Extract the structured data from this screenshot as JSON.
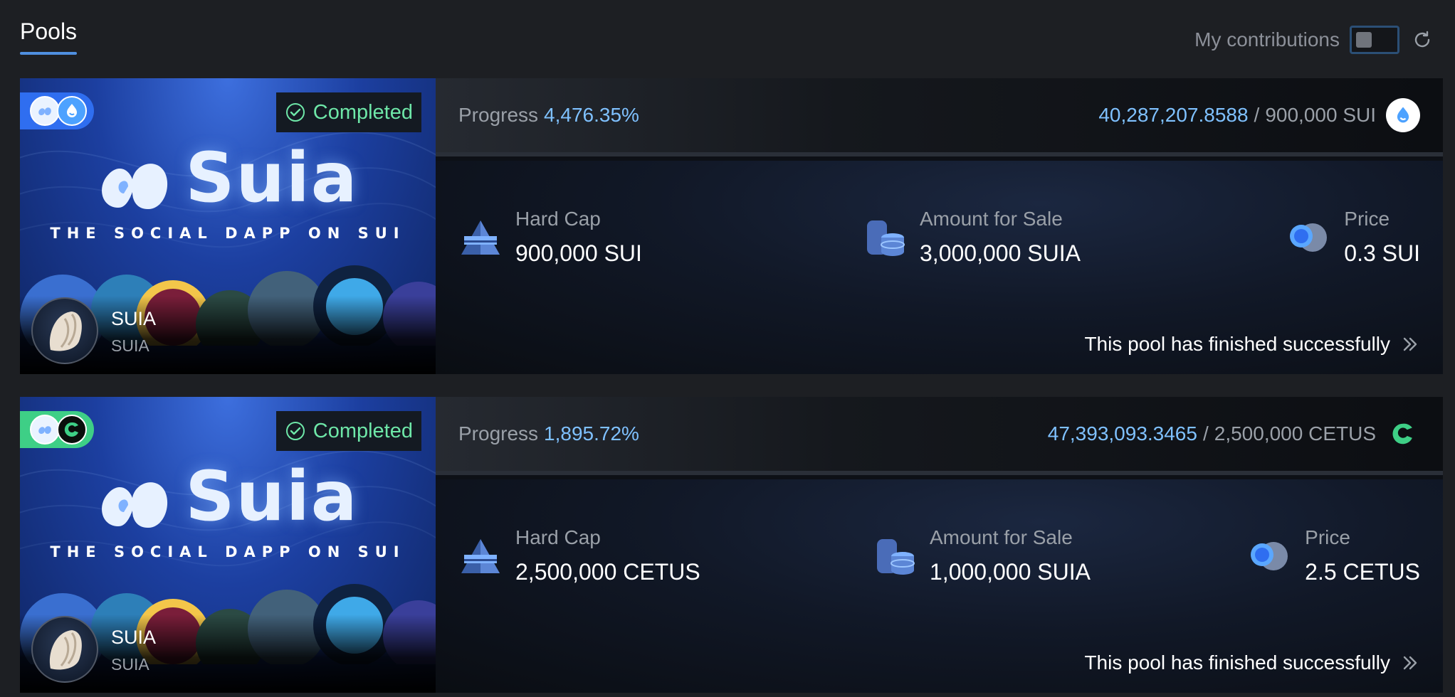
{
  "header": {
    "tab_label": "Pools",
    "contributions_label": "My contributions",
    "toggle_state": "off",
    "refresh_icon": "refresh-icon"
  },
  "pools": [
    {
      "status": "Completed",
      "banner": {
        "logo_word": "Suia",
        "tagline": "THE SOCIAL DAPP ON SUI"
      },
      "chain_icons": [
        "suia-icon",
        "sui-icon"
      ],
      "token_name": "SUIA",
      "token_symbol": "SUIA",
      "progress_label": "Progress",
      "progress_value": "4,476.35%",
      "raised_amount": "40,287,207.8588",
      "raised_separator": "/",
      "raised_target": "900,000 SUI",
      "raise_coin_icon": "sui-icon",
      "hard_cap_label": "Hard Cap",
      "hard_cap_value": "900,000 SUI",
      "amount_label": "Amount for Sale",
      "amount_value": "3,000,000 SUIA",
      "price_label": "Price",
      "price_value": "0.3 SUI",
      "finish_text": "This pool has finished successfully"
    },
    {
      "status": "Completed",
      "banner": {
        "logo_word": "Suia",
        "tagline": "THE SOCIAL DAPP ON SUI"
      },
      "chain_icons": [
        "suia-icon",
        "cetus-icon"
      ],
      "token_name": "SUIA",
      "token_symbol": "SUIA",
      "progress_label": "Progress",
      "progress_value": "1,895.72%",
      "raised_amount": "47,393,093.3465",
      "raised_separator": "/",
      "raised_target": "2,500,000 CETUS",
      "raise_coin_icon": "cetus-icon",
      "hard_cap_label": "Hard Cap",
      "hard_cap_value": "2,500,000 CETUS",
      "amount_label": "Amount for Sale",
      "amount_value": "1,000,000 SUIA",
      "price_label": "Price",
      "price_value": "2.5 CETUS",
      "finish_text": "This pool has finished successfully"
    }
  ],
  "colors": {
    "background": "#1d1f23",
    "accent_blue": "#7fc1ff",
    "completed_green": "#6ee7a8",
    "sui_badge": "#2f6ef0",
    "cetus_badge": "#3ecf86"
  }
}
